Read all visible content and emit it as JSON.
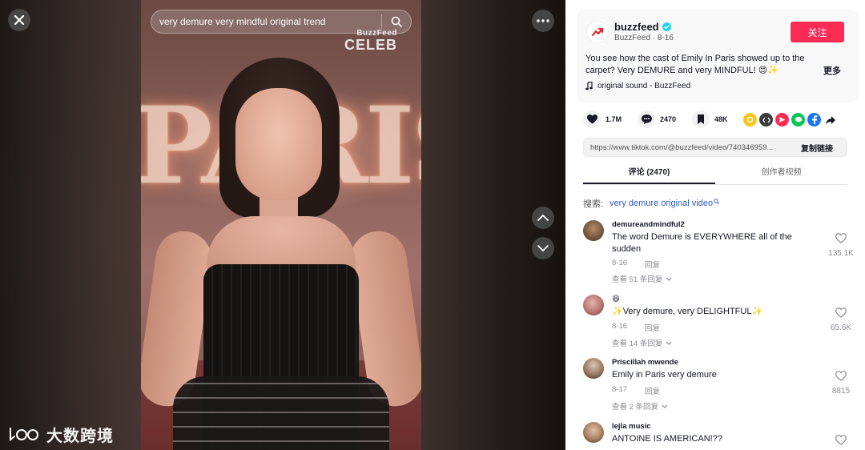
{
  "video": {
    "search_query": "very demure very mindful original trend",
    "watermark_top": "BuzzFeed",
    "watermark_bottom": "CELEB",
    "sign_text": "PARIS"
  },
  "overlay": {
    "logo_text": "大数跨境"
  },
  "post": {
    "author": "buzzfeed",
    "author_sub": "BuzzFeed · 8-16",
    "follow_label": "关注",
    "description": "You see how the cast of Emily In Paris showed up to the carpet? Very DEMURE and very MINDFUL! 😍✨",
    "more_label": "更多",
    "sound": "original sound - BuzzFeed",
    "likes": "1.7M",
    "comments": "2470",
    "saves": "48K",
    "link_url": "https://www.tiktok.com/@buzzfeed/video/740346959...",
    "copy_label": "复制链接"
  },
  "tabs": [
    {
      "label": "评论 (2470)",
      "active": true
    },
    {
      "label": "创作者视频",
      "active": false
    }
  ],
  "related_search": {
    "label": "搜索:",
    "query": "very demure original video"
  },
  "comments": [
    {
      "name": "demureandmindful2",
      "text": "The word Demure is EVERYWHERE all of the sudden",
      "date": "8-16",
      "reply": "回复",
      "replies": "查看 51 条回复",
      "likes": "135.1K"
    },
    {
      "name": "😆",
      "text": "✨Very demure, very DELIGHTFUL✨",
      "date": "8-16",
      "reply": "回复",
      "replies": "查看 14 条回复",
      "likes": "65.6K"
    },
    {
      "name": "Priscillah mwende",
      "text": "Emily in Paris very demure",
      "date": "8-17",
      "reply": "回复",
      "replies": "查看 2 条回复",
      "likes": "8815"
    },
    {
      "name": "lejla music",
      "text": "ANTOINE IS AMERICAN!??",
      "date": "",
      "reply": "",
      "replies": "",
      "likes": ""
    }
  ],
  "colors": {
    "follow": "#fe2c55",
    "link": "#2b5cc8",
    "verified": "#20d5ec"
  }
}
